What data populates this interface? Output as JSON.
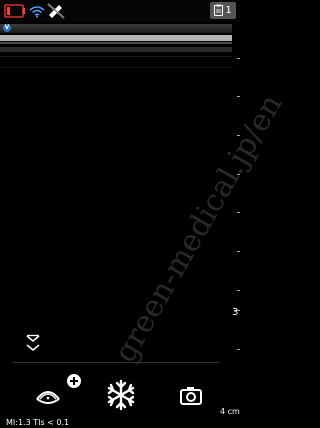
{
  "status": {
    "battery": "battery-icon",
    "wifi": "wifi-icon",
    "no_phone": "no-phone-icon",
    "clipboard_count": "1"
  },
  "image": {
    "probe_marker": "V",
    "watermark": "green-medical.jp/en",
    "scale_label": "3"
  },
  "footer": {
    "mi_tis": "MI:1.3  TIs < 0.1",
    "depth": "4 cm"
  },
  "toolbar": {
    "add_icon": "plus-icon",
    "mode_icon": "probe-mode-icon",
    "freeze_icon": "snowflake-icon",
    "camera_icon": "camera-icon",
    "chevron_icon": "double-chevron-down-icon"
  },
  "colors": {
    "background": "#000000",
    "marker_blue": "#2f73c7",
    "badge_bg": "#555555"
  }
}
